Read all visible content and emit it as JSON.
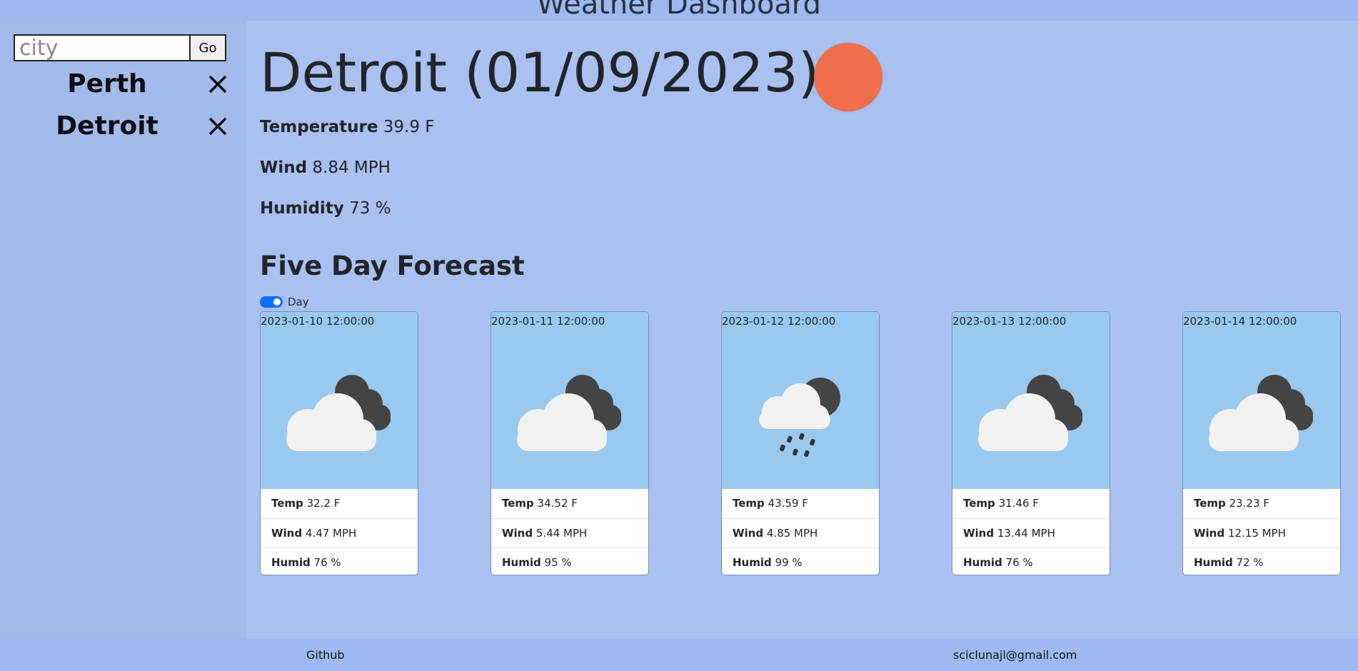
{
  "header": {
    "title": "Weather Dashboard"
  },
  "sidebar": {
    "search": {
      "placeholder": "city",
      "value": "",
      "go_label": "Go"
    },
    "history": [
      {
        "label": "Perth"
      },
      {
        "label": "Detroit"
      }
    ]
  },
  "current": {
    "heading": "Detroit (01/09/2023)",
    "icon": "sun-icon",
    "sun_color": "#ef6e4b",
    "temperature_label": "Temperature",
    "temperature_value": "39.9 F",
    "wind_label": "Wind",
    "wind_value": "8.84 MPH",
    "humidity_label": "Humidity",
    "humidity_value": "73 %"
  },
  "forecast": {
    "title": "Five Day Forecast",
    "toggle_label": "Day",
    "toggle_on": true,
    "temp_label": "Temp",
    "wind_label": "Wind",
    "humid_label": "Humid",
    "days": [
      {
        "date": "2023-01-10 12:00:00",
        "icon": "cloudy-night-icon",
        "temp": "32.2 F",
        "wind": "4.47 MPH",
        "humid": "76 %"
      },
      {
        "date": "2023-01-11 12:00:00",
        "icon": "cloudy-night-icon",
        "temp": "34.52 F",
        "wind": "5.44 MPH",
        "humid": "95 %"
      },
      {
        "date": "2023-01-12 12:00:00",
        "icon": "snow-night-icon",
        "temp": "43.59 F",
        "wind": "4.85 MPH",
        "humid": "99 %"
      },
      {
        "date": "2023-01-13 12:00:00",
        "icon": "cloudy-night-icon",
        "temp": "31.46 F",
        "wind": "13.44 MPH",
        "humid": "76 %"
      },
      {
        "date": "2023-01-14 12:00:00",
        "icon": "cloudy-night-icon",
        "temp": "23.23 F",
        "wind": "12.15 MPH",
        "humid": "72 %"
      }
    ]
  },
  "footer": {
    "github_label": "Github",
    "email": "sciclunajl@gmail.com"
  }
}
